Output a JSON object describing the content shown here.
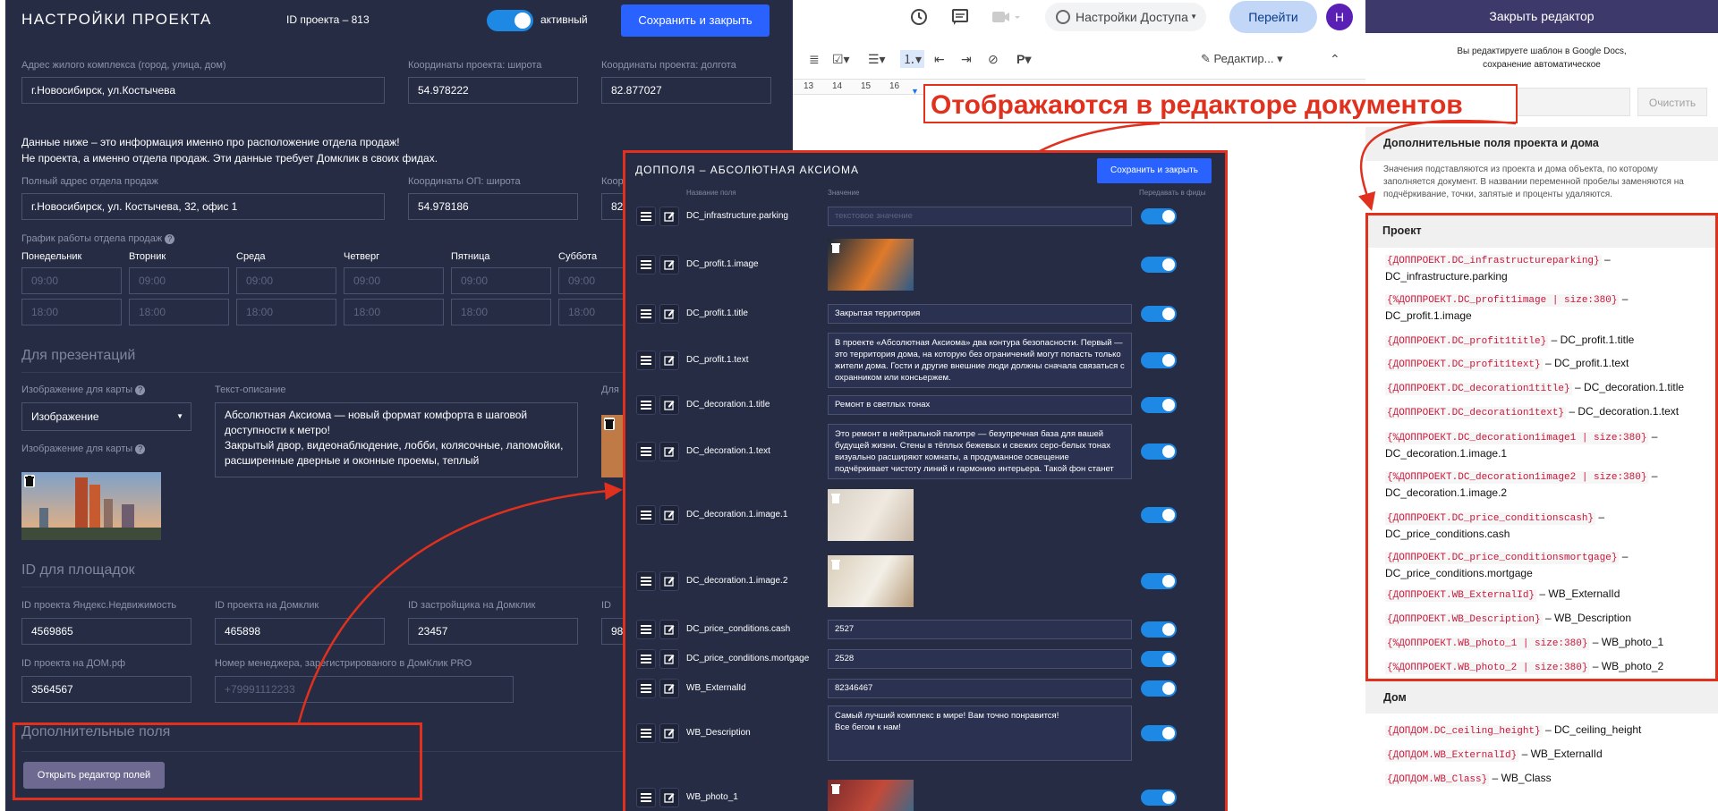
{
  "project": {
    "header_title": "НАСТРОЙКИ ПРОЕКТА",
    "id_label": "ID проекта – 813",
    "active_label": "активный",
    "save_close": "Сохранить и закрыть",
    "address_label": "Адрес жилого комплекса (город, улица, дом)",
    "address_value": "г.Новосибирск, ул.Костычева",
    "lat_label": "Координаты проекта: широта",
    "lat_value": "54.978222",
    "lon_label": "Координаты проекта: долгота",
    "lon_value": "82.877027",
    "note_line1": "Данные ниже – это информация именно про расположение отдела продаж!",
    "note_line2": "Не проекта, а именно отдела продаж. Эти данные требует Домклик в своих фидах.",
    "office_label": "Полный адрес отдела продаж",
    "office_value": "г.Новосибирск, ул. Костычева, 32, офис 1",
    "op_lat_label": "Координаты ОП: широта",
    "op_lat_value": "54.978186",
    "op_lon_label_cut": "Коор",
    "op_lon_value_cut": "82",
    "schedule_label": "График работы отдела продаж",
    "days": [
      "Понедельник",
      "Вторник",
      "Среда",
      "Четверг",
      "Пятница",
      "Суббота"
    ],
    "time_open": "09:00",
    "time_close": "18:00",
    "presentations_title": "Для презентаций",
    "map_image_label": "Изображение для карты",
    "map_image_select": "Изображение",
    "map_image_label2": "Изображение для карты",
    "text_desc_label": "Текст-описание",
    "text_desc_value": "Абсолютная Аксиома — новый формат комфорта в шаговой доступности к метро!\nЗакрытый двор, видеонаблюдение, лобби, колясочные, лапомойки, расширенные дверные и оконные проемы, теплый",
    "cut_label_dlya": "Для",
    "ids_title": "ID для площадок",
    "yandex_label": "ID проекта Яндекс.Недвижимость",
    "yandex_value": "4569865",
    "domclick_label": "ID проекта на Домклик",
    "domclick_value": "465898",
    "developer_label": "ID застройщика на Домклик",
    "developer_value": "23457",
    "cut_id_label": "ID",
    "cut_id_value": "98",
    "domrf_label": "ID проекта на ДОМ.рф",
    "domrf_value": "3564567",
    "manager_label": "Номер менеджера, зарегистрированого в ДомКлик PRO",
    "manager_placeholder": "+79991112233",
    "extra_title": "Дополнительные поля",
    "open_editor": "Открыть редактор полей"
  },
  "gdocs": {
    "access_label": "Настройки Доступа",
    "go_button": "Перейти",
    "avatar_letter": "Н",
    "edit_mode": "Редактир...",
    "ruler": [
      "13",
      "14",
      "15",
      "16"
    ]
  },
  "callout": "Отображаются в редакторе документов",
  "modal": {
    "title": "ДОППОЛЯ – АБСОЛЮТНАЯ АКСИОМА",
    "save_close": "Сохранить и закрыть",
    "col_name": "Название поля",
    "col_value": "Значение",
    "col_feed": "Передавать в фиды",
    "value_placeholder": "текстовое значение",
    "rows": [
      {
        "name": "DC_infrastructure.parking",
        "value": ""
      },
      {
        "name": "DC_profit.1.image",
        "value": ""
      },
      {
        "name": "DC_profit.1.title",
        "value": "Закрытая территория"
      },
      {
        "name": "DC_profit.1.text",
        "value": "В проекте «Абсолютная Аксиома» два контура безопасности. Первый — это территория дома, на которую без ограничений могут попасть только жители дома. Гости и другие внешние люди должны сначала связаться с охранником или консьержем."
      },
      {
        "name": "DC_decoration.1.title",
        "value": "Ремонт в светлых тонах"
      },
      {
        "name": "DC_decoration.1.text",
        "value": "Это ремонт в нейтральной палитре — безупречная база для вашей будущей жизни. Стены в тёплых бежевых и свежих серо-белых тонах визуально расширяют комнаты, а продуманное освещение подчёркивает чистоту линий и гармонию интерьера. Такой фон станет"
      },
      {
        "name": "DC_decoration.1.image.1",
        "value": ""
      },
      {
        "name": "DC_decoration.1.image.2",
        "value": ""
      },
      {
        "name": "DC_price_conditions.cash",
        "value": "2527"
      },
      {
        "name": "DC_price_conditions.mortgage",
        "value": "2528"
      },
      {
        "name": "WB_ExternalId",
        "value": "82346467"
      },
      {
        "name": "WB_Description",
        "value": "Самый лучший комплекс в мире! Вам точно понравится!\nВсе бегом к нам!"
      },
      {
        "name": "WB_photo_1",
        "value": ""
      }
    ]
  },
  "editor": {
    "close_label": "Закрыть редактор",
    "info_line1": "Вы редактируете шаблон в Google Docs,",
    "info_line2": "сохранение автоматическое",
    "clear_button": "Очистить",
    "fields_title": "Дополнительные поля проекта и дома",
    "fields_desc": "Значения подставляются из проекта и дома объекта, по которому заполняется документ. В названии переменной пробелы заменяются на подчёркивание, точки, запятые и проценты удаляются.",
    "project_title": "Проект",
    "project_rows": [
      {
        "tag": "{ДОППРОЕКТ.DC_infrastructureparking}",
        "desc": "DC_infrastructure.parking"
      },
      {
        "tag": "{%ДОППРОЕКТ.DC_profit1image | size:380}",
        "desc": "DC_profit.1.image"
      },
      {
        "tag": "{ДОППРОЕКТ.DC_profit1title}",
        "desc": "DC_profit.1.title"
      },
      {
        "tag": "{ДОППРОЕКТ.DC_profit1text}",
        "desc": "DC_profit.1.text"
      },
      {
        "tag": "{ДОППРОЕКТ.DC_decoration1title}",
        "desc": "DC_decoration.1.title"
      },
      {
        "tag": "{ДОППРОЕКТ.DC_decoration1text}",
        "desc": "DC_decoration.1.text"
      },
      {
        "tag": "{%ДОППРОЕКТ.DC_decoration1image1 | size:380}",
        "desc": "DC_decoration.1.image.1"
      },
      {
        "tag": "{%ДОППРОЕКТ.DC_decoration1image2 | size:380}",
        "desc": "DC_decoration.1.image.2"
      },
      {
        "tag": "{ДОППРОЕКТ.DC_price_conditionscash}",
        "desc": "DC_price_conditions.cash"
      },
      {
        "tag": "{ДОППРОЕКТ.DC_price_conditionsmortgage}",
        "desc": "DC_price_conditions.mortgage"
      },
      {
        "tag": "{ДОППРОЕКТ.WB_ExternalId}",
        "desc": "WB_ExternalId"
      },
      {
        "tag": "{ДОППРОЕКТ.WB_Description}",
        "desc": "WB_Description"
      },
      {
        "tag": "{%ДОППРОЕКТ.WB_photo_1 | size:380}",
        "desc": "WB_photo_1"
      },
      {
        "tag": "{%ДОППРОЕКТ.WB_photo_2 | size:380}",
        "desc": "WB_photo_2"
      }
    ],
    "house_title": "Дом",
    "house_rows": [
      {
        "tag": "{ДОПДОМ.DC_ceiling_height}",
        "desc": "DC_ceiling_height"
      },
      {
        "tag": "{ДОПДОМ.WB_ExternalId}",
        "desc": "WB_ExternalId"
      },
      {
        "tag": "{ДОПДОМ.WB_Class}",
        "desc": "WB_Class"
      }
    ]
  },
  "colors": {
    "panel_dark": "#262c44",
    "accent_blue": "#2962ff",
    "toggle_blue": "#1e88e5",
    "annotation_red": "#e0301e",
    "editor_purple": "#3d3a6b"
  }
}
